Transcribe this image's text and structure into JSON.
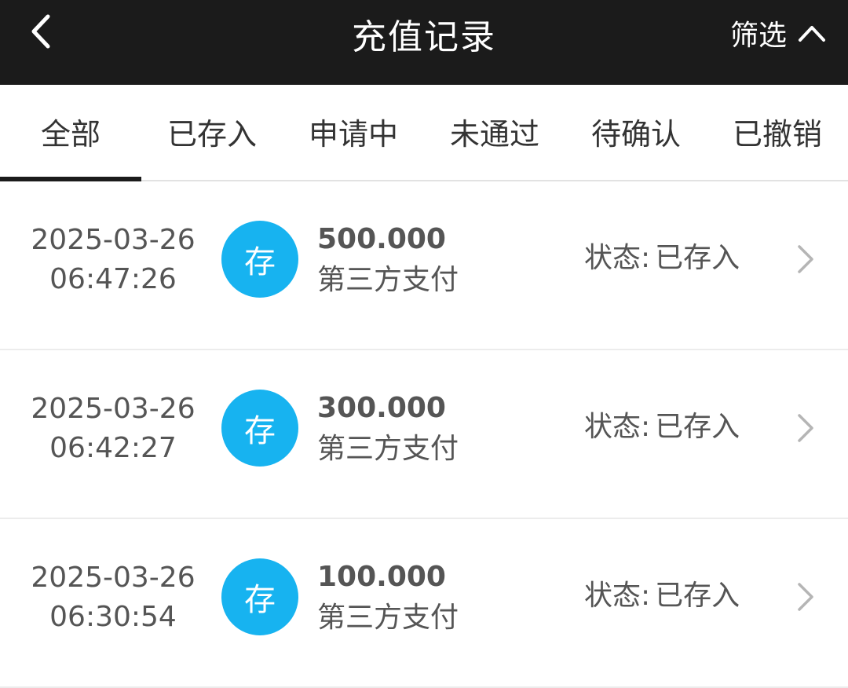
{
  "header": {
    "back_icon": "chevron-left-icon",
    "title": "充值记录",
    "filter_label": "筛选",
    "filter_icon": "chevron-up-icon"
  },
  "tabs": [
    {
      "label": "全部",
      "active": true
    },
    {
      "label": "已存入",
      "active": false
    },
    {
      "label": "申请中",
      "active": false
    },
    {
      "label": "未通过",
      "active": false
    },
    {
      "label": "待确认",
      "active": false
    },
    {
      "label": "已撤销",
      "active": false
    }
  ],
  "records": [
    {
      "date": "2025-03-26",
      "time": "06:47:26",
      "badge": "存",
      "amount": "500.000",
      "method": "第三方支付",
      "status_label": "状态:",
      "status_value": "已存入"
    },
    {
      "date": "2025-03-26",
      "time": "06:42:27",
      "badge": "存",
      "amount": "300.000",
      "method": "第三方支付",
      "status_label": "状态:",
      "status_value": "已存入"
    },
    {
      "date": "2025-03-26",
      "time": "06:30:54",
      "badge": "存",
      "amount": "100.000",
      "method": "第三方支付",
      "status_label": "状态:",
      "status_value": "已存入"
    }
  ],
  "colors": {
    "header_bg": "#1b1b1b",
    "badge_bg": "#17b3f0",
    "active_tab_indicator": "#1b1b1b"
  }
}
